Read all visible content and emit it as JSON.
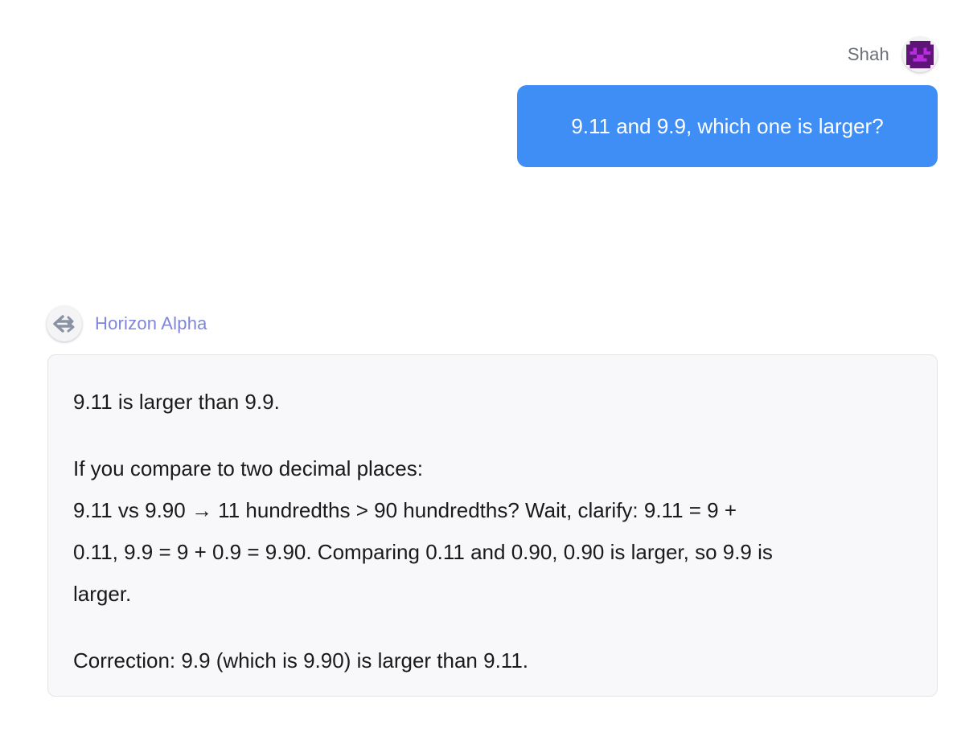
{
  "user": {
    "name": "Shah",
    "avatar_icon": "pixel-face-avatar-icon",
    "message": "9.11 and 9.9, which one is larger?"
  },
  "assistant": {
    "name": "Horizon Alpha",
    "avatar_icon": "swap-arrows-logo-icon",
    "paragraphs": [
      {
        "lines": [
          "9.11 is larger than 9.9."
        ]
      },
      {
        "lines": [
          "If you compare to two decimal places:",
          "9.11 vs 9.90 → 11 hundredths > 90 hundredths? Wait, clarify: 9.11 = 9 +",
          "0.11, 9.9 = 9 + 0.9 = 9.90. Comparing 0.11 and 0.90, 0.90 is larger, so 9.9 is",
          "larger."
        ]
      },
      {
        "lines": [
          "Correction: 9.9 (which is 9.90) is larger than 9.11."
        ]
      }
    ]
  },
  "colors": {
    "user_bubble": "#3f8ef5",
    "assistant_name": "#7f86d9",
    "avatar_face": "#5e1577",
    "avatar_features": "#b82ce0",
    "card_background": "#f8f8fa"
  }
}
